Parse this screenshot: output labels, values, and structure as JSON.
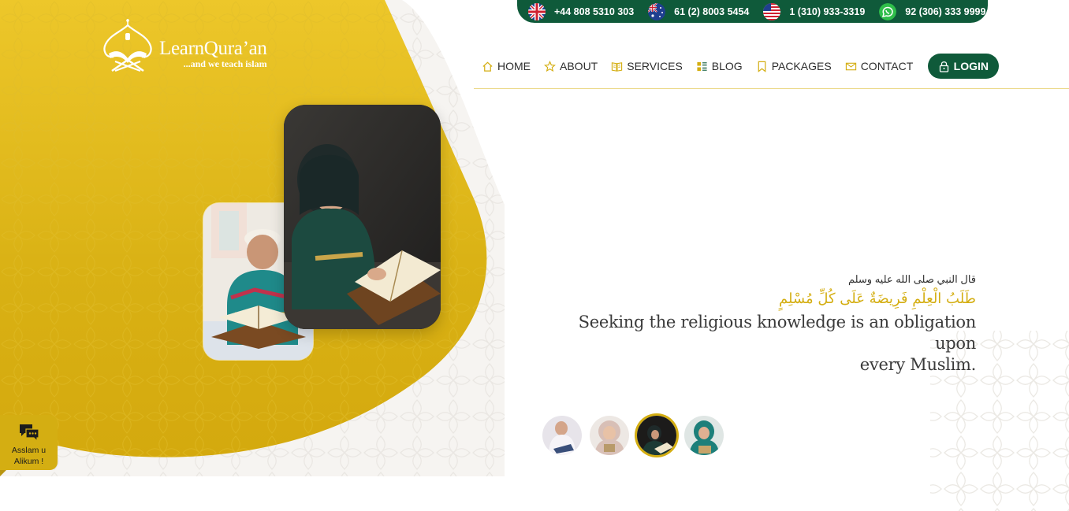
{
  "brand": {
    "name": "LearnQura’an",
    "tagline": "...and we teach islam"
  },
  "phones": [
    {
      "flag": "uk-flag-icon",
      "number": "+44 808 5310 303"
    },
    {
      "flag": "australia-flag-icon",
      "number": "61 (2) 8003 5454"
    },
    {
      "flag": "usa-flag-icon",
      "number": "1 (310) 933-3319"
    },
    {
      "flag": "whatsapp-icon",
      "number": "92 (306) 333 9999"
    }
  ],
  "nav": {
    "items": [
      {
        "label": "HOME",
        "icon": "home-icon"
      },
      {
        "label": "ABOUT",
        "icon": "star-icon"
      },
      {
        "label": "SERVICES",
        "icon": "book-icon"
      },
      {
        "label": "BLOG",
        "icon": "list-icon"
      },
      {
        "label": "PACKAGES",
        "icon": "bookmark-icon"
      },
      {
        "label": "CONTACT",
        "icon": "mail-icon"
      }
    ],
    "login_label": "LOGIN"
  },
  "hero": {
    "attribution": "قال النبي صلى الله عليه وسلم",
    "arabic": "طَلَبُ الْعِلْمِ فَرِيضَةٌ عَلَى كُلِّ مُسْلِمٍ",
    "english_line1": "Seeking the religious knowledge is an obligation upon",
    "english_line2": "every Muslim."
  },
  "chat": {
    "label": "Asslam u Alikum !"
  },
  "colors": {
    "gold": "#d4ae12",
    "green": "#0f5a3a",
    "text": "#2e2e2e"
  }
}
